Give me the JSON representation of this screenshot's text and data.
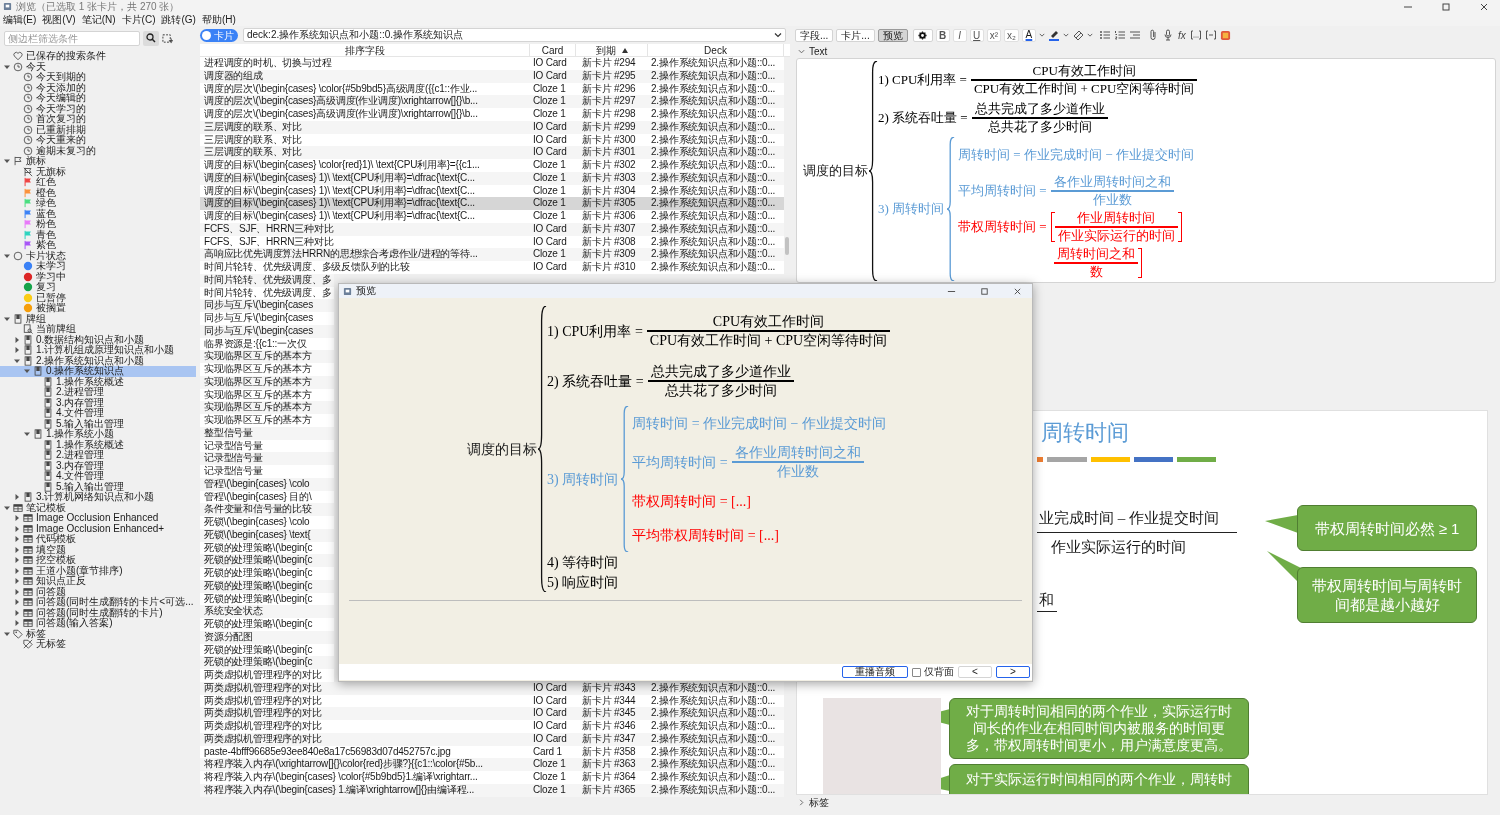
{
  "window": {
    "title": "浏览（已选取 1 张卡片，共 270 张）"
  },
  "menu": [
    "编辑(E)",
    "视图(V)",
    "笔记(N)",
    "卡片(C)",
    "跳转(G)",
    "帮助(H)"
  ],
  "sidebar": {
    "search": {
      "placeholder": "侧边栏筛选条件"
    },
    "items": [
      {
        "label": "已保存的搜索条件",
        "kind": "heart",
        "selected": false
      },
      {
        "label": "今天",
        "kind": "clock",
        "expanded": true,
        "selected": false,
        "children": [
          {
            "label": "今天到期的",
            "kind": "clock",
            "selected": false
          },
          {
            "label": "今天添加的",
            "kind": "clock",
            "selected": false
          },
          {
            "label": "今天编辑的",
            "kind": "clock",
            "selected": false
          },
          {
            "label": "今天学习的",
            "kind": "clock",
            "selected": false
          },
          {
            "label": "首次复习的",
            "kind": "clock",
            "selected": false
          },
          {
            "label": "已重新排期",
            "kind": "clock",
            "selected": false
          },
          {
            "label": "今天重来的",
            "kind": "clock",
            "selected": false
          },
          {
            "label": "逾期未复习的",
            "kind": "clock",
            "selected": false
          }
        ]
      },
      {
        "label": "旗标",
        "kind": "flag",
        "expanded": true,
        "selected": false,
        "children": [
          {
            "label": "无旗标",
            "kind": "noflag",
            "selected": false
          },
          {
            "label": "红色",
            "kind": "flag-filled",
            "color": "#ef4444",
            "selected": false
          },
          {
            "label": "橙色",
            "kind": "flag-filled",
            "color": "#fb923c",
            "selected": false
          },
          {
            "label": "绿色",
            "kind": "flag-filled",
            "color": "#4ade80",
            "selected": false
          },
          {
            "label": "蓝色",
            "kind": "flag-filled",
            "color": "#3b82f6",
            "selected": false
          },
          {
            "label": "粉色",
            "kind": "flag-filled",
            "color": "#e879f9",
            "selected": false
          },
          {
            "label": "青色",
            "kind": "flag-filled",
            "color": "#2dd4bf",
            "selected": false
          },
          {
            "label": "紫色",
            "kind": "flag-filled",
            "color": "#a855f7",
            "selected": false
          }
        ]
      },
      {
        "label": "卡片状态",
        "kind": "circle",
        "expanded": true,
        "selected": false,
        "children": [
          {
            "label": "未学习",
            "kind": "dot",
            "color": "#3b82f6",
            "selected": false
          },
          {
            "label": "学习中",
            "kind": "dot",
            "color": "#dc2626",
            "selected": false
          },
          {
            "label": "复习",
            "kind": "dot",
            "color": "#16a34a",
            "selected": false
          },
          {
            "label": "已暂停",
            "kind": "dot",
            "color": "#facc15",
            "selected": false
          },
          {
            "label": "被搁置",
            "kind": "dot",
            "color": "#f59e0b",
            "selected": false
          }
        ]
      },
      {
        "label": "牌组",
        "kind": "deck",
        "expanded": true,
        "selected": false,
        "children": [
          {
            "label": "当前牌组",
            "kind": "current-deck",
            "selected": false
          },
          {
            "label": "0.数据结构知识点和小题",
            "kind": "deck",
            "expanded": false,
            "selected": false
          },
          {
            "label": "1.计算机组成原理知识点和小题",
            "kind": "deck",
            "expanded": false,
            "selected": false
          },
          {
            "label": "2.操作系统知识点和小题",
            "kind": "deck",
            "expanded": true,
            "selected": false,
            "children": [
              {
                "label": "0.操作系统知识点",
                "kind": "deck",
                "expanded": true,
                "selected": true,
                "children": [
                  {
                    "label": "1.操作系统概述",
                    "kind": "deck",
                    "selected": false
                  },
                  {
                    "label": "2.进程管理",
                    "kind": "deck",
                    "selected": false
                  },
                  {
                    "label": "3.内存管理",
                    "kind": "deck",
                    "selected": false
                  },
                  {
                    "label": "4.文件管理",
                    "kind": "deck",
                    "selected": false
                  },
                  {
                    "label": "5.输入输出管理",
                    "kind": "deck",
                    "selected": false
                  }
                ]
              },
              {
                "label": "1.操作系统小题",
                "kind": "deck",
                "expanded": true,
                "selected": false,
                "children": [
                  {
                    "label": "1.操作系统概述",
                    "kind": "deck",
                    "selected": false
                  },
                  {
                    "label": "2.进程管理",
                    "kind": "deck",
                    "selected": false
                  },
                  {
                    "label": "3.内存管理",
                    "kind": "deck",
                    "selected": false
                  },
                  {
                    "label": "4.文件管理",
                    "kind": "deck",
                    "selected": false
                  },
                  {
                    "label": "5.输入输出管理",
                    "kind": "deck",
                    "selected": false
                  }
                ]
              }
            ]
          },
          {
            "label": "3.计算机网络知识点和小题",
            "kind": "deck",
            "expanded": false,
            "selected": false
          }
        ]
      },
      {
        "label": "笔记模板",
        "kind": "notetype",
        "expanded": true,
        "selected": false,
        "children": [
          {
            "label": "Image Occlusion Enhanced",
            "kind": "notetype",
            "expanded": false,
            "selected": false
          },
          {
            "label": "Image Occlusion Enhanced+",
            "kind": "notetype",
            "expanded": false,
            "selected": false
          },
          {
            "label": "代码模板",
            "kind": "notetype",
            "expanded": false,
            "selected": false
          },
          {
            "label": "填空题",
            "kind": "notetype",
            "expanded": false,
            "selected": false
          },
          {
            "label": "挖空模板",
            "kind": "notetype",
            "expanded": false,
            "selected": false
          },
          {
            "label": "王道小题(章节排序)",
            "kind": "notetype",
            "expanded": false,
            "selected": false
          },
          {
            "label": "知识点正反",
            "kind": "notetype",
            "expanded": false,
            "selected": false
          },
          {
            "label": "问答题",
            "kind": "notetype",
            "expanded": false,
            "selected": false
          },
          {
            "label": "问答题(同时生成翻转的卡片<可选...",
            "kind": "notetype",
            "expanded": false,
            "selected": false
          },
          {
            "label": "问答题(同时生成翻转的卡片)",
            "kind": "notetype",
            "expanded": false,
            "selected": false
          },
          {
            "label": "问答题(输入答案)",
            "kind": "notetype",
            "expanded": false,
            "selected": false
          }
        ]
      },
      {
        "label": "标签",
        "kind": "tag",
        "expanded": true,
        "selected": false,
        "children": [
          {
            "label": "无标签",
            "kind": "notag",
            "selected": false
          }
        ]
      }
    ]
  },
  "table": {
    "toggle": {
      "label": "卡片",
      "on": true
    },
    "search": {
      "value": "deck:2.操作系统知识点和小题::0.操作系统知识点"
    },
    "columns": [
      {
        "label": "排序字段",
        "sorted": false
      },
      {
        "label": "Card",
        "sorted": false
      },
      {
        "label": "到期",
        "sorted": true
      },
      {
        "label": "Deck",
        "sorted": false
      }
    ],
    "rows": [
      {
        "sort_field": "进程调度的时机、切换与过程",
        "card": "IO Card",
        "due": "新卡片 #294",
        "deck": "2.操作系统知识点和小题::0...",
        "selected": false
      },
      {
        "sort_field": "调度器的组成",
        "card": "IO Card",
        "due": "新卡片 #295",
        "deck": "2.操作系统知识点和小题::0...",
        "selected": false
      },
      {
        "sort_field": "调度的层次\\(\\begin{cases} \\color{#5b9bd5}高级调度({{c1::作业...",
        "card": "Cloze 1",
        "due": "新卡片 #296",
        "deck": "2.操作系统知识点和小题::0...",
        "selected": false
      },
      {
        "sort_field": "调度的层次\\(\\begin{cases}高级调度(作业调度)\\xrightarrow[]{}\\b...",
        "card": "Cloze 1",
        "due": "新卡片 #297",
        "deck": "2.操作系统知识点和小题::0...",
        "selected": false
      },
      {
        "sort_field": "调度的层次\\(\\begin{cases}高级调度(作业调度)\\xrightarrow[]{}\\b...",
        "card": "Cloze 1",
        "due": "新卡片 #298",
        "deck": "2.操作系统知识点和小题::0...",
        "selected": false
      },
      {
        "sort_field": "三层调度的联系、对比",
        "card": "IO Card",
        "due": "新卡片 #299",
        "deck": "2.操作系统知识点和小题::0...",
        "selected": false
      },
      {
        "sort_field": "三层调度的联系、对比",
        "card": "IO Card",
        "due": "新卡片 #300",
        "deck": "2.操作系统知识点和小题::0...",
        "selected": false
      },
      {
        "sort_field": "三层调度的联系、对比",
        "card": "IO Card",
        "due": "新卡片 #301",
        "deck": "2.操作系统知识点和小题::0...",
        "selected": false
      },
      {
        "sort_field": "调度的目标\\(\\begin{cases} \\color{red}1)\\ \\text{CPU利用率}={{c1...",
        "card": "Cloze 1",
        "due": "新卡片 #302",
        "deck": "2.操作系统知识点和小题::0...",
        "selected": false
      },
      {
        "sort_field": "调度的目标\\(\\begin{cases} 1)\\ \\text{CPU利用率}=\\dfrac{\\text{C...",
        "card": "Cloze 1",
        "due": "新卡片 #303",
        "deck": "2.操作系统知识点和小题::0...",
        "selected": false
      },
      {
        "sort_field": "调度的目标\\(\\begin{cases} 1)\\ \\text{CPU利用率}=\\dfrac{\\text{C...",
        "card": "Cloze 1",
        "due": "新卡片 #304",
        "deck": "2.操作系统知识点和小题::0...",
        "selected": false
      },
      {
        "sort_field": "调度的目标\\(\\begin{cases} 1)\\ \\text{CPU利用率}=\\dfrac{\\text{C...",
        "card": "Cloze 1",
        "due": "新卡片 #305",
        "deck": "2.操作系统知识点和小题::0...",
        "selected": true
      },
      {
        "sort_field": "调度的目标\\(\\begin{cases} 1)\\ \\text{CPU利用率}=\\dfrac{\\text{C...",
        "card": "Cloze 1",
        "due": "新卡片 #306",
        "deck": "2.操作系统知识点和小题::0...",
        "selected": false
      },
      {
        "sort_field": "FCFS、SJF、HRRN三种对比",
        "card": "IO Card",
        "due": "新卡片 #307",
        "deck": "2.操作系统知识点和小题::0...",
        "selected": false
      },
      {
        "sort_field": "FCFS、SJF、HRRN三种对比",
        "card": "IO Card",
        "due": "新卡片 #308",
        "deck": "2.操作系统知识点和小题::0...",
        "selected": false
      },
      {
        "sort_field": "高响应比优先调度算法HRRN的思想综合考虑作业/进程的等待...",
        "card": "Cloze 1",
        "due": "新卡片 #309",
        "deck": "2.操作系统知识点和小题::0...",
        "selected": false
      },
      {
        "sort_field": "时间片轮转、优先级调度、多级反馈队列的比较",
        "card": "IO Card",
        "due": "新卡片 #310",
        "deck": "2.操作系统知识点和小题::0...",
        "selected": false
      },
      {
        "sort_field": "时间片轮转、优先级调度、多",
        "selected": false
      },
      {
        "sort_field": "时间片轮转、优先级调度、多",
        "selected": false
      },
      {
        "sort_field": "同步与互斥\\(\\begin{cases",
        "selected": false
      },
      {
        "sort_field": "同步与互斥\\(\\begin{cases",
        "selected": false
      },
      {
        "sort_field": "同步与互斥\\(\\begin{cases",
        "selected": false
      },
      {
        "sort_field": "临界资源是:{{c1::一次仅",
        "selected": false
      },
      {
        "sort_field": "实现临界区互斥的基本方",
        "selected": false
      },
      {
        "sort_field": "实现临界区互斥的基本方",
        "selected": false
      },
      {
        "sort_field": "实现临界区互斥的基本方",
        "selected": false
      },
      {
        "sort_field": "实现临界区互斥的基本方",
        "selected": false
      },
      {
        "sort_field": "实现临界区互斥的基本方",
        "selected": false
      },
      {
        "sort_field": "实现临界区互斥的基本方",
        "selected": false
      },
      {
        "sort_field": "整型信号量",
        "selected": false
      },
      {
        "sort_field": "记录型信号量",
        "selected": false
      },
      {
        "sort_field": "记录型信号量",
        "selected": false
      },
      {
        "sort_field": "记录型信号量",
        "selected": false
      },
      {
        "sort_field": "管程\\(\\begin{cases} \\colo",
        "selected": false
      },
      {
        "sort_field": "管程\\(\\begin{cases} 目的\\",
        "selected": false
      },
      {
        "sort_field": "条件变量和信号量的比较",
        "selected": false
      },
      {
        "sort_field": "死锁\\(\\begin{cases} \\colo",
        "selected": false
      },
      {
        "sort_field": "死锁\\(\\begin{cases} \\text{",
        "selected": false
      },
      {
        "sort_field": "死锁的处理策略\\(\\begin{c",
        "selected": false
      },
      {
        "sort_field": "死锁的处理策略\\(\\begin{c",
        "selected": false
      },
      {
        "sort_field": "死锁的处理策略\\(\\begin{c",
        "selected": false
      },
      {
        "sort_field": "死锁的处理策略\\(\\begin{c",
        "selected": false
      },
      {
        "sort_field": "死锁的处理策略\\(\\begin{c",
        "selected": false
      },
      {
        "sort_field": "系统安全状态",
        "selected": false
      },
      {
        "sort_field": "死锁的处理策略\\(\\begin{c",
        "selected": false
      },
      {
        "sort_field": "资源分配图",
        "selected": false
      },
      {
        "sort_field": "死锁的处理策略\\(\\begin{c",
        "selected": false
      },
      {
        "sort_field": "死锁的处理策略\\(\\begin{c",
        "selected": false
      },
      {
        "sort_field": "两类虚拟机管理程序的对比",
        "selected": false
      },
      {
        "sort_field": "两类虚拟机管理程序的对比",
        "card": "IO Card",
        "due": "新卡片 #343",
        "deck": "2.操作系统知识点和小题::0...",
        "selected": false
      },
      {
        "sort_field": "两类虚拟机管理程序的对比",
        "card": "IO Card",
        "due": "新卡片 #344",
        "deck": "2.操作系统知识点和小题::0...",
        "selected": false
      },
      {
        "sort_field": "两类虚拟机管理程序的对比",
        "card": "IO Card",
        "due": "新卡片 #345",
        "deck": "2.操作系统知识点和小题::0...",
        "selected": false
      },
      {
        "sort_field": "两类虚拟机管理程序的对比",
        "card": "IO Card",
        "due": "新卡片 #346",
        "deck": "2.操作系统知识点和小题::0...",
        "selected": false
      },
      {
        "sort_field": "两类虚拟机管理程序的对比",
        "card": "IO Card",
        "due": "新卡片 #347",
        "deck": "2.操作系统知识点和小题::0...",
        "selected": false
      },
      {
        "sort_field": "paste-4bfff96685e93ee840e8a17c56983d07d452757c.jpg",
        "card": "Card 1",
        "due": "新卡片 #358",
        "deck": "2.操作系统知识点和小题::0...",
        "selected": false
      },
      {
        "sort_field": "将程序装入内存\\(\\xrightarrow[]{}\\color{red}步骤?}{{c1::\\color{#5b...",
        "card": "Cloze 1",
        "due": "新卡片 #363",
        "deck": "2.操作系统知识点和小题::0...",
        "selected": false
      },
      {
        "sort_field": "将程序装入内存\\(\\begin{cases} \\color{#5b9bd5}1.编译\\xrightarr...",
        "card": "Cloze 1",
        "due": "新卡片 #364",
        "deck": "2.操作系统知识点和小题::0...",
        "selected": false
      },
      {
        "sort_field": "将程序装入内存\\(\\begin{cases} 1.编译\\xrightarrow[]{}由编译程...",
        "card": "Cloze 1",
        "due": "新卡片 #365",
        "deck": "2.操作系统知识点和小题::0...",
        "selected": false
      }
    ]
  },
  "editor": {
    "toolbar": {
      "buttons": [
        {
          "label": "字段...",
          "pressed": false
        },
        {
          "label": "卡片...",
          "pressed": false
        },
        {
          "label": "预览",
          "pressed": true
        }
      ],
      "format": [
        "B",
        "I",
        "U",
        "x²",
        "x₂"
      ],
      "text_color_label": "A",
      "function_label": "fx"
    },
    "field": {
      "name": "Text",
      "expanded": true
    },
    "math": {
      "goal": "调度的目标",
      "items": [
        {
          "kind": "fraction",
          "label": "1) CPU利用率 =",
          "numerator": "CPU有效工作时间",
          "denominator": "CPU有效工作时间 + CPU空闲等待时间",
          "color": "#000000"
        },
        {
          "kind": "fraction",
          "label": "2) 系统吞吐量 =",
          "numerator": "总共完成了多少道作业",
          "denominator": "总共花了多少时间",
          "color": "#000000"
        },
        {
          "kind": "brace",
          "label": "3) 周转时间",
          "color": "#5b9bd5",
          "children": [
            {
              "kind": "text",
              "label": "周转时间 = 作业完成时间 − 作业提交时间",
              "color": "#5b9bd5"
            },
            {
              "kind": "fraction",
              "label": "平均周转时间 =",
              "numerator": "各作业周转时间之和",
              "denominator": "作业数",
              "color": "#5b9bd5"
            },
            {
              "kind": "bracket-fraction",
              "label": "带权周转时间 =",
              "numerator": "作业周转时间",
              "denominator": "作业实际运行的时间",
              "color": "#ff0000"
            },
            {
              "kind": "fragment",
              "numerator": "周转时间之和",
              "denominator": "数",
              "color": "#ff0000"
            }
          ]
        }
      ]
    },
    "slide": {
      "title": "周转时间",
      "lines": [
        "业完成时间 – 作业提交时间",
        "作业实际运行的时间",
        "和"
      ],
      "callouts": [
        "带权周转时间必然 ≥ 1",
        "带权周转时间与周转时间都是越小越好",
        "对于周转时间相同的两个作业，实际运行时间长的作业在相同时间内被服务的时间更多，带权周转时间更小，用户满意度更高。",
        "对于实际运行时间相同的两个作业，周转时"
      ]
    },
    "tags": {
      "label": "标签",
      "expanded": false
    }
  },
  "preview": {
    "title": "预览",
    "math": {
      "goal": "调度的目标",
      "items": [
        {
          "kind": "fraction",
          "label": "1) CPU利用率 =",
          "numerator": "CPU有效工作时间",
          "denominator": "CPU有效工作时间 + CPU空闲等待时间",
          "color": "#000000"
        },
        {
          "kind": "fraction",
          "label": "2) 系统吞吐量 =",
          "numerator": "总共完成了多少道作业",
          "denominator": "总共花了多少时间",
          "color": "#000000"
        },
        {
          "kind": "brace",
          "label": "3) 周转时间",
          "color": "#5b9bd5",
          "children": [
            {
              "kind": "text",
              "label": "周转时间 = 作业完成时间 − 作业提交时间",
              "color": "#5b9bd5"
            },
            {
              "kind": "fraction",
              "label": "平均周转时间 =",
              "numerator": "各作业周转时间之和",
              "denominator": "作业数",
              "color": "#5b9bd5"
            },
            {
              "kind": "text",
              "label": "带权周转时间 = [...]",
              "color": "#ff0000"
            },
            {
              "kind": "text",
              "label": "平均带权周转时间 = [...]",
              "color": "#ff0000"
            }
          ]
        },
        {
          "kind": "text",
          "label": "4) 等待时间",
          "color": "#000000"
        },
        {
          "kind": "text",
          "label": "5) 响应时间",
          "color": "#000000"
        }
      ]
    },
    "replay_button": "重播音频",
    "back_only": {
      "label": "仅背面",
      "checked": false
    },
    "nav": [
      "<",
      ">"
    ]
  }
}
